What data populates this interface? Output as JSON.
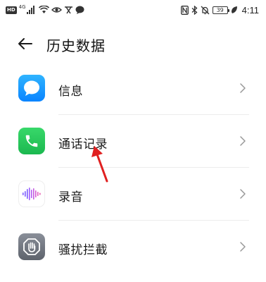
{
  "status_bar": {
    "hd_label": "HD",
    "network_label": "4G",
    "battery_text": "39",
    "time": "4:11"
  },
  "header": {
    "title": "历史数据"
  },
  "list": [
    {
      "label": "信息",
      "icon": "messages-icon"
    },
    {
      "label": "通话记录",
      "icon": "phone-icon"
    },
    {
      "label": "录音",
      "icon": "recorder-icon"
    },
    {
      "label": "骚扰拦截",
      "icon": "blocker-icon"
    }
  ],
  "colors": {
    "messages": "#0a84ff",
    "phone": "#1bb84f",
    "recorder_wave": "#7a5cff",
    "blocker": "#5e636c",
    "annotation_arrow": "#e02020"
  }
}
